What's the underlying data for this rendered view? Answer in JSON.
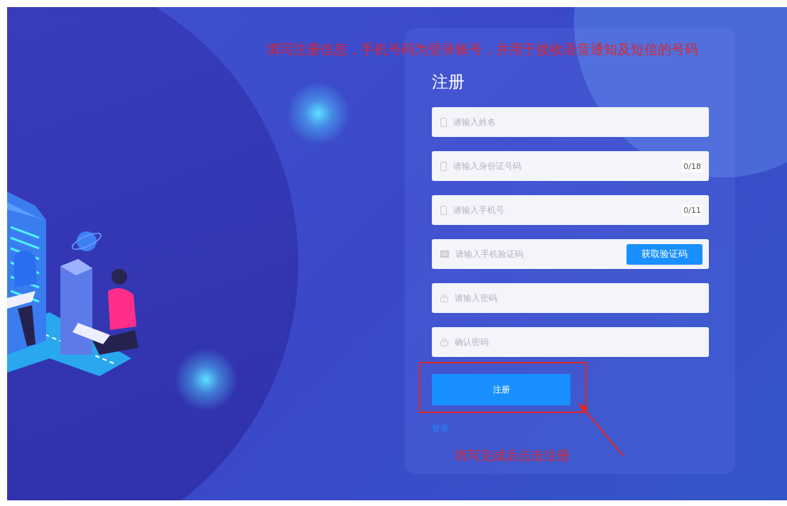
{
  "form": {
    "title": "注册",
    "fields": [
      {
        "kind": "phone",
        "placeholder": "请输入姓名"
      },
      {
        "kind": "phone",
        "placeholder": "请输入身份证号码",
        "counter": "0/18"
      },
      {
        "kind": "phone",
        "placeholder": "请输入手机号",
        "counter": "0/11"
      },
      {
        "kind": "code",
        "placeholder": "请输入手机验证码",
        "button": "获取验证码"
      },
      {
        "kind": "lock",
        "placeholder": "请输入密码"
      },
      {
        "kind": "lock",
        "placeholder": "确认密码"
      }
    ],
    "submit": "注册",
    "login_link": "登录"
  },
  "annotations": {
    "top_note": "填写注册信息，手机号码为登录账号，并用于接收语音通知及短信的号码",
    "bottom_note": "填写完成后点击注册"
  }
}
